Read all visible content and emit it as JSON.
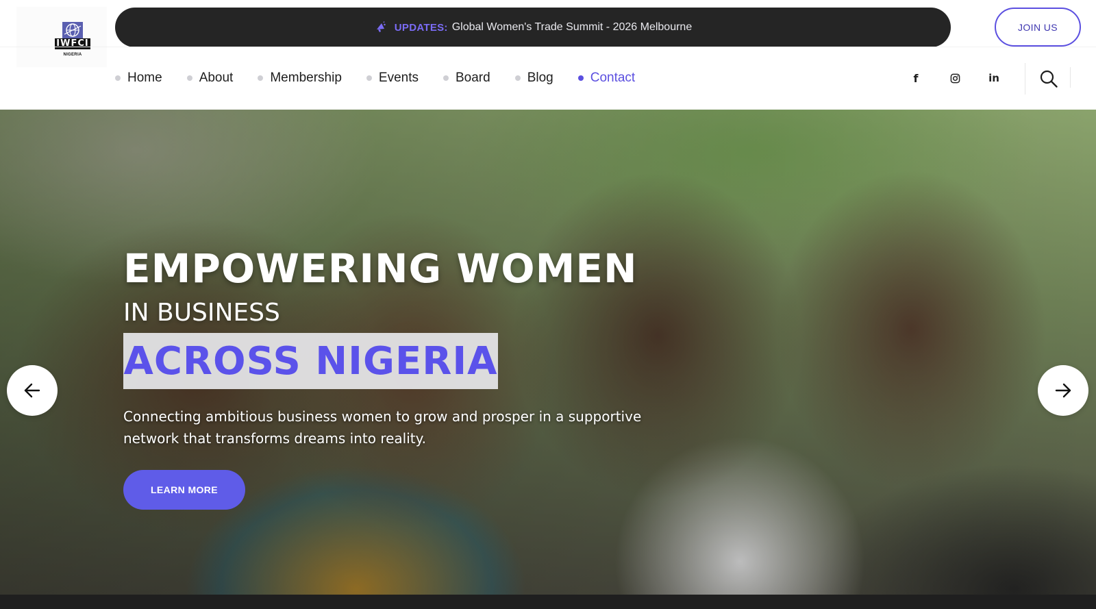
{
  "brand": {
    "logo_text": "IWFCI",
    "logo_sub": "NIGERIA"
  },
  "updates": {
    "label": "UPDATES:",
    "text": "Global Women's Trade Summit - 2026 Melbourne",
    "icon": "megaphone-icon"
  },
  "header": {
    "join_label": "JOIN US"
  },
  "nav": {
    "items": [
      {
        "label": "Home",
        "active": false
      },
      {
        "label": "About",
        "active": false
      },
      {
        "label": "Membership",
        "active": false
      },
      {
        "label": "Events",
        "active": false
      },
      {
        "label": "Board",
        "active": false
      },
      {
        "label": "Blog",
        "active": false
      },
      {
        "label": "Contact",
        "active": true
      }
    ]
  },
  "social": {
    "facebook": "f",
    "instagram": "instagram-icon",
    "linkedin": "in"
  },
  "hero": {
    "title": "EMPOWERING WOMEN",
    "subtitle": "IN BUSINESS",
    "highlight": "ACROSS NIGERIA",
    "description": "Connecting ambitious business women to grow and prosper in a supportive network that transforms dreams into reality.",
    "cta_label": "LEARN MORE"
  },
  "colors": {
    "accent": "#5b4fe0",
    "dark_bar": "#252525",
    "highlight_text": "#5b52ea"
  }
}
